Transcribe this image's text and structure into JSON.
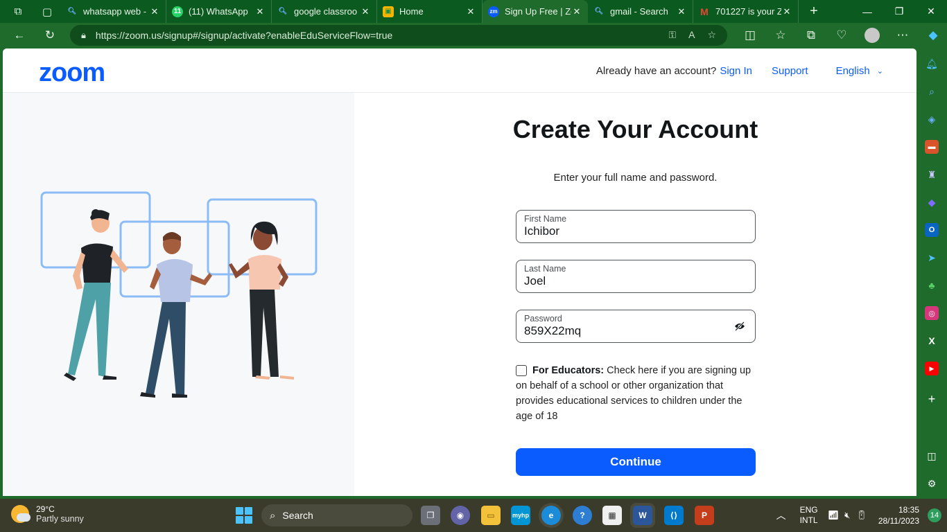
{
  "browser": {
    "tabs": [
      {
        "title": "whatsapp web -",
        "icon": "search-icon",
        "color": "#3a7bd5"
      },
      {
        "title": "(11) WhatsApp",
        "icon": "whatsapp-icon",
        "color": "#25d366"
      },
      {
        "title": "google classroo",
        "icon": "search-icon",
        "color": "#3a7bd5"
      },
      {
        "title": "Home",
        "icon": "classroom-icon",
        "color": "#f4b400"
      },
      {
        "title": "Sign Up Free | Zo",
        "icon": "zoom-icon",
        "color": "#0b5cff",
        "active": true
      },
      {
        "title": "gmail - Search",
        "icon": "search-icon",
        "color": "#3a7bd5"
      },
      {
        "title": "701227 is your Z",
        "icon": "gmail-icon",
        "color": "#ea4335"
      }
    ],
    "url": "https://zoom.us/signup#/signup/activate?enableEduServiceFlow=true"
  },
  "header": {
    "logo": "zoom",
    "account_prompt": "Already have an account?",
    "sign_in": "Sign In",
    "support": "Support",
    "language": "English"
  },
  "form": {
    "title": "Create Your Account",
    "subtitle": "Enter your full name and password.",
    "first_name_label": "First Name",
    "first_name_value": "Ichibor",
    "last_name_label": "Last Name",
    "last_name_value": "Joel",
    "password_label": "Password",
    "password_value": "859X22mq",
    "educators_bold": "For Educators:",
    "educators_text": "Check here if you are signing up on behalf of a school or other organization that provides educational services to children under the age of 18",
    "educators_checked": false,
    "continue_label": "Continue"
  },
  "taskbar": {
    "weather_temp": "29°C",
    "weather_desc": "Partly sunny",
    "search_label": "Search",
    "lang_top": "ENG",
    "lang_bottom": "INTL",
    "time": "18:35",
    "date": "28/11/2023",
    "notification_count": "14"
  },
  "colors": {
    "brand": "#0b5cff",
    "browser_theme": "#1f6b2c"
  }
}
